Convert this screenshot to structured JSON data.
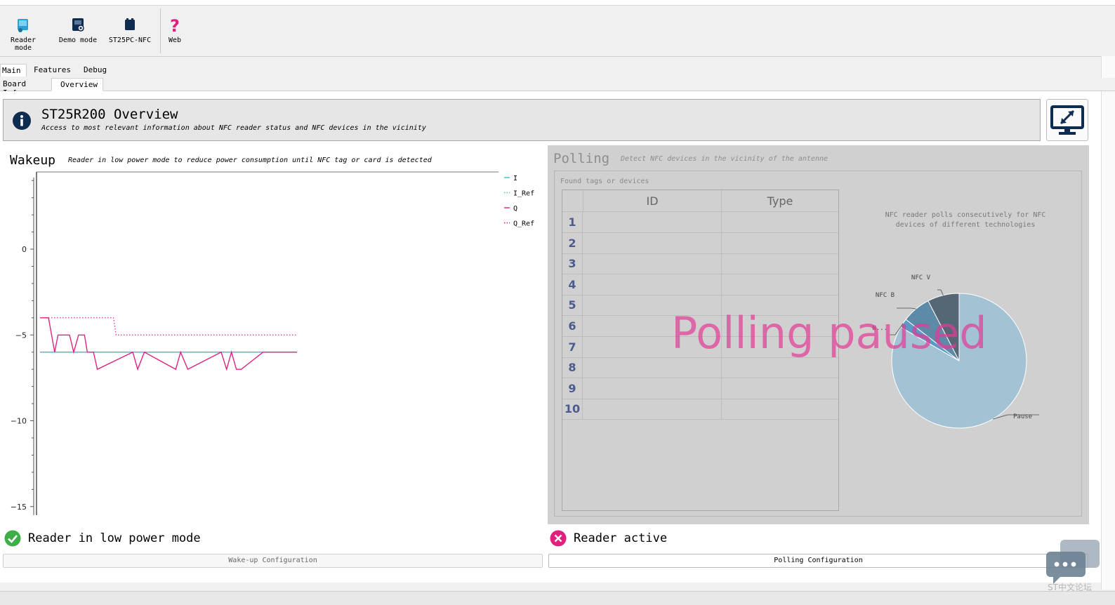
{
  "toolbar": {
    "buttons": [
      {
        "label": "Reader mode",
        "icon": "reader-mode-icon"
      },
      {
        "label": "Demo mode",
        "icon": "demo-mode-icon"
      },
      {
        "label": "ST25PC-NFC",
        "icon": "st25pc-nfc-icon"
      },
      {
        "label": "Web",
        "icon": "web-help-icon"
      }
    ]
  },
  "tabs": {
    "main": [
      {
        "label": "Main"
      },
      {
        "label": "Features"
      },
      {
        "label": "Debug"
      }
    ],
    "sub": [
      {
        "label": "Board Info"
      },
      {
        "label": "Overview"
      }
    ]
  },
  "header": {
    "title": "ST25R200 Overview",
    "subtitle": "Access to most relevant information about NFC reader status and NFC devices in the vicinity"
  },
  "wakeup": {
    "title": "Wakeup",
    "subtitle": "Reader in low power mode to reduce power consumption until NFC tag or card is detected",
    "status": "Reader in low power mode",
    "config_button": "Wake-up Configuration"
  },
  "polling": {
    "title": "Polling",
    "subtitle": "Detect NFC devices in the vicinity of the antenne",
    "found_label": "Found tags or devices",
    "table": {
      "columns": [
        "ID",
        "Type"
      ],
      "rows": [
        "1",
        "2",
        "3",
        "4",
        "5",
        "6",
        "7",
        "8",
        "9",
        "10"
      ]
    },
    "pie_description": "NFC reader polls consecutively for NFC devices of different technologies",
    "overlay": "Polling paused",
    "status": "Reader active",
    "config_button": "Polling Configuration"
  },
  "watermark": "ST中文论坛",
  "chart_data": [
    {
      "type": "line",
      "title": "",
      "xlabel": "",
      "ylabel": "",
      "ylim": [
        -15.5,
        4.5
      ],
      "yticks": [
        0,
        -5,
        -10,
        -15
      ],
      "grid": false,
      "legend_placement": "right",
      "series": [
        {
          "name": "I",
          "color": "#3cb8d8",
          "style": "solid",
          "x": [
            0,
            100
          ],
          "y": [
            -6,
            -6
          ]
        },
        {
          "name": "I_Ref",
          "color": "#3cb8d8",
          "style": "dotted",
          "x": [
            0,
            100
          ],
          "y": [
            -6,
            -6
          ]
        },
        {
          "name": "Q",
          "color": "#e0247f",
          "style": "solid",
          "x": [
            0,
            3.3,
            5.7,
            7.0,
            11.5,
            13.1,
            15.0,
            17.3,
            18.4,
            20.8,
            22.3,
            36.1,
            38.0,
            40.6,
            52.8,
            54.7,
            57.5,
            70.5,
            72.6,
            74.5,
            76.4,
            78.3,
            86.8,
            90.1,
            100
          ],
          "y": [
            -4,
            -4,
            -6,
            -5,
            -5,
            -6,
            -5,
            -5,
            -6,
            -6,
            -7,
            -6,
            -7,
            -6,
            -7,
            -6,
            -7,
            -6,
            -7,
            -6,
            -7,
            -7,
            -6,
            -6,
            -6
          ]
        },
        {
          "name": "Q_Ref",
          "color": "#e0247f",
          "style": "dotted",
          "x": [
            0,
            28.6,
            29.6,
            100
          ],
          "y": [
            -4,
            -4,
            -5,
            -5
          ]
        }
      ]
    },
    {
      "type": "pie",
      "title": "",
      "slices": [
        {
          "label": "Pause",
          "value": 83.3,
          "color": "#a3c3d5"
        },
        {
          "label": "N...",
          "value": 2.2,
          "color": "#5b9ac4"
        },
        {
          "label": "NFC B",
          "value": 6.9,
          "color": "#5c8aa7"
        },
        {
          "label": "NFC V",
          "value": 7.6,
          "color": "#556674"
        }
      ]
    }
  ]
}
